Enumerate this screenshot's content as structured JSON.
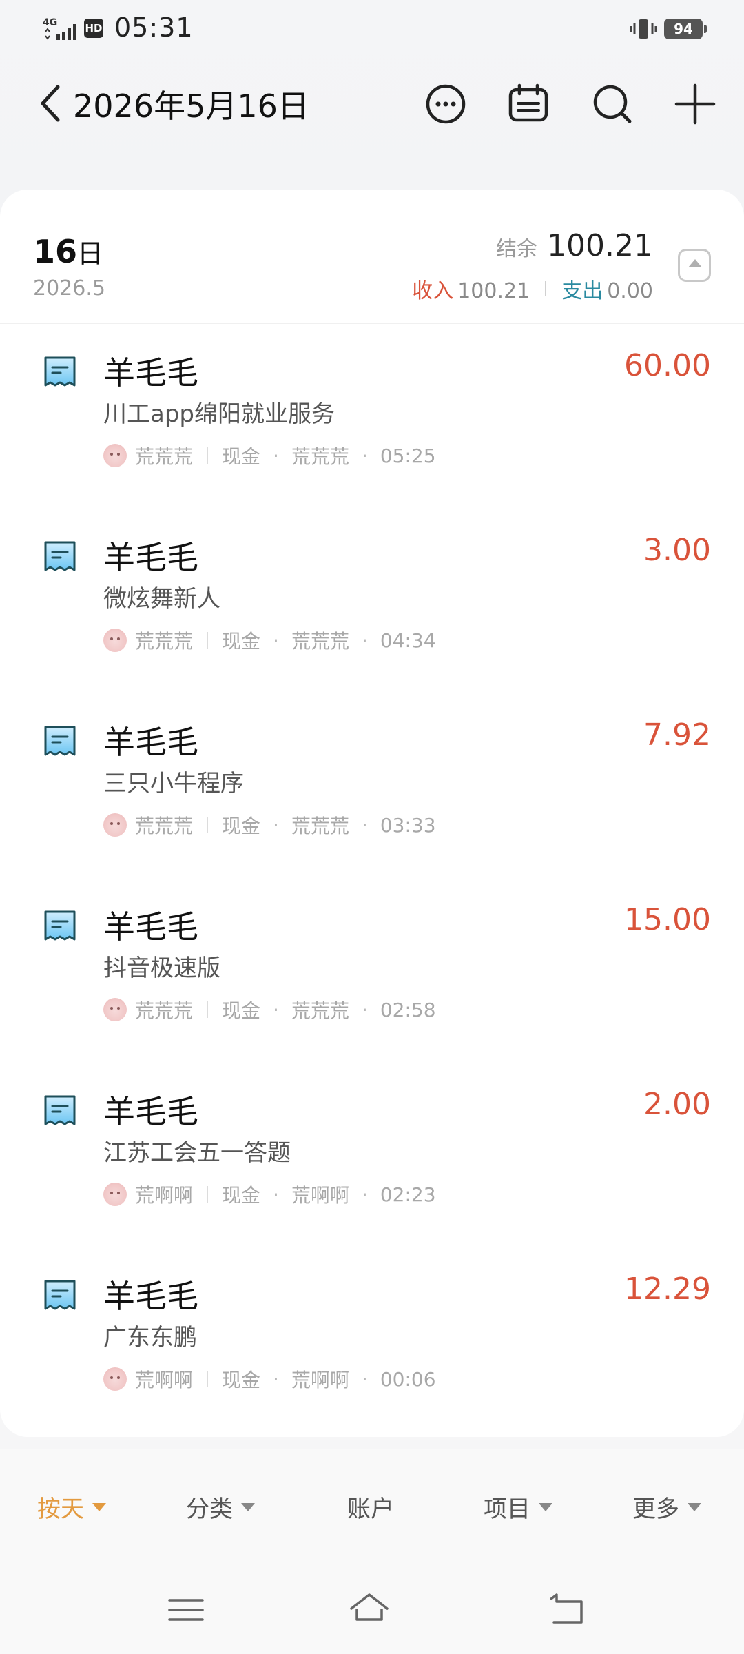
{
  "status_bar": {
    "network": "4G",
    "hd": "HD",
    "time": "05:31",
    "battery": "94",
    "icons": [
      "signal-icon",
      "vibrate-icon",
      "battery-icon"
    ]
  },
  "header": {
    "title": "2026年5月16日",
    "icons": [
      "chevron-left-icon",
      "more-circle-icon",
      "calendar-icon",
      "search-icon",
      "plus-icon"
    ]
  },
  "day_summary": {
    "day": "16",
    "day_suffix": "日",
    "month": "2026.5",
    "balance_label": "结余",
    "balance": "100.21",
    "income_label": "收入",
    "income": "100.21",
    "expense_label": "支出",
    "expense": "0.00"
  },
  "entries": [
    {
      "title": "羊毛毛",
      "amount": "60.00",
      "desc": "川工app绵阳就业服务",
      "member": "荒荒荒",
      "account": "现金",
      "person": "荒荒荒",
      "time": "05:25"
    },
    {
      "title": "羊毛毛",
      "amount": "3.00",
      "desc": "微炫舞新人",
      "member": "荒荒荒",
      "account": "现金",
      "person": "荒荒荒",
      "time": "04:34"
    },
    {
      "title": "羊毛毛",
      "amount": "7.92",
      "desc": "三只小牛程序",
      "member": "荒荒荒",
      "account": "现金",
      "person": "荒荒荒",
      "time": "03:33"
    },
    {
      "title": "羊毛毛",
      "amount": "15.00",
      "desc": "抖音极速版",
      "member": "荒荒荒",
      "account": "现金",
      "person": "荒荒荒",
      "time": "02:58"
    },
    {
      "title": "羊毛毛",
      "amount": "2.00",
      "desc": "江苏工会五一答题",
      "member": "荒啊啊",
      "account": "现金",
      "person": "荒啊啊",
      "time": "02:23"
    },
    {
      "title": "羊毛毛",
      "amount": "12.29",
      "desc": "广东东鹏",
      "member": "荒啊啊",
      "account": "现金",
      "person": "荒啊啊",
      "time": "00:06"
    }
  ],
  "meta_dot": "·",
  "tabs": {
    "day": "按天",
    "category": "分类",
    "account": "账户",
    "project": "项目",
    "more": "更多"
  },
  "colors": {
    "accent": "#e39a3f",
    "income": "#d9533a",
    "expense": "#2a8aa0"
  }
}
